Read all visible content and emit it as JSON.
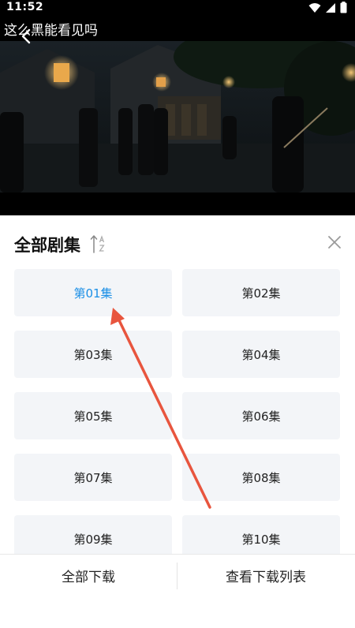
{
  "status_bar": {
    "time": "11:52"
  },
  "video": {
    "title": "这么黑能看见吗"
  },
  "sheet": {
    "title": "全部剧集",
    "episodes": [
      {
        "label": "第01集",
        "active": true
      },
      {
        "label": "第02集",
        "active": false
      },
      {
        "label": "第03集",
        "active": false
      },
      {
        "label": "第04集",
        "active": false
      },
      {
        "label": "第05集",
        "active": false
      },
      {
        "label": "第06集",
        "active": false
      },
      {
        "label": "第07集",
        "active": false
      },
      {
        "label": "第08集",
        "active": false
      },
      {
        "label": "第09集",
        "active": false
      },
      {
        "label": "第10集",
        "active": false
      }
    ]
  },
  "bottom": {
    "download_all": "全部下载",
    "view_downloads": "查看下载列表"
  },
  "colors": {
    "accent": "#1b8fe6",
    "card_bg": "#f3f5f8",
    "annotation_arrow": "#e8553e"
  }
}
